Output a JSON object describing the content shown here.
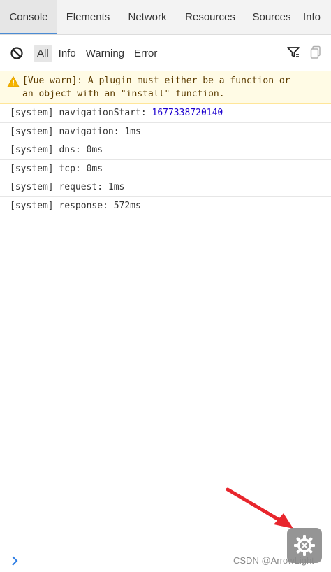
{
  "tabs": [
    {
      "label": "Console",
      "active": true
    },
    {
      "label": "Elements"
    },
    {
      "label": "Network"
    },
    {
      "label": "Resources"
    },
    {
      "label": "Sources"
    },
    {
      "label": "Info"
    }
  ],
  "toolbar": {
    "filters": [
      "All",
      "Info",
      "Warning",
      "Error"
    ],
    "selected_filter": "All",
    "icons": [
      "clear-icon",
      "filter-icon",
      "copy-icon"
    ]
  },
  "logs": {
    "warning": {
      "text": "[Vue warn]: A plugin must either be a function or\nan object with an \"install\" function."
    },
    "rows": [
      {
        "text": "[system] navigationStart: ",
        "value": "1677338720140"
      },
      {
        "text": "[system] navigation: 1ms",
        "value": ""
      },
      {
        "text": "[system] dns: 0ms",
        "value": ""
      },
      {
        "text": "[system] tcp: 0ms",
        "value": ""
      },
      {
        "text": "[system] request: 1ms",
        "value": ""
      },
      {
        "text": "[system] response: 572ms",
        "value": ""
      }
    ]
  },
  "watermark": "CSDN @ArrowLight",
  "colors": {
    "accent": "#4b8bd4",
    "warning_bg": "#fffbe5",
    "number": "#1c00cf",
    "annotation_arrow": "#e8262d"
  }
}
